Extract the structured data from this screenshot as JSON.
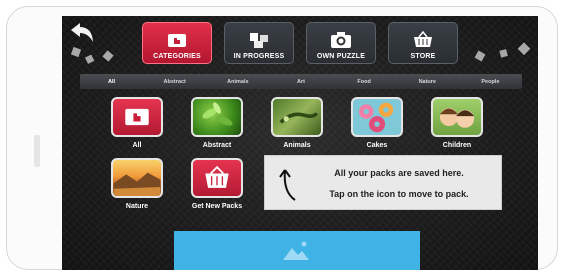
{
  "toolbar": {
    "buttons": [
      {
        "label": "CATEGORIES",
        "icon": "categories-icon",
        "active": true
      },
      {
        "label": "IN PROGRESS",
        "icon": "puzzle-pieces-icon",
        "active": false
      },
      {
        "label": "OWN PUZZLE",
        "icon": "camera-icon",
        "active": false
      },
      {
        "label": "STORE",
        "icon": "basket-icon",
        "active": false
      }
    ]
  },
  "tabs": [
    "All",
    "Abstract",
    "Animals",
    "Art",
    "Food",
    "Nature",
    "People"
  ],
  "selected_tab": "All",
  "categories": [
    {
      "label": "All"
    },
    {
      "label": "Abstract"
    },
    {
      "label": "Animals"
    },
    {
      "label": "Cakes"
    },
    {
      "label": "Children"
    },
    {
      "label": "Nature"
    },
    {
      "label": "Get New Packs"
    }
  ],
  "info": {
    "line1": "All your packs are saved here.",
    "line2": "Tap on the icon to move to pack."
  },
  "colors": {
    "accent_red": "#d0233d",
    "banner_blue": "#3fb2e6",
    "tab_bar": "#3a3d42"
  }
}
